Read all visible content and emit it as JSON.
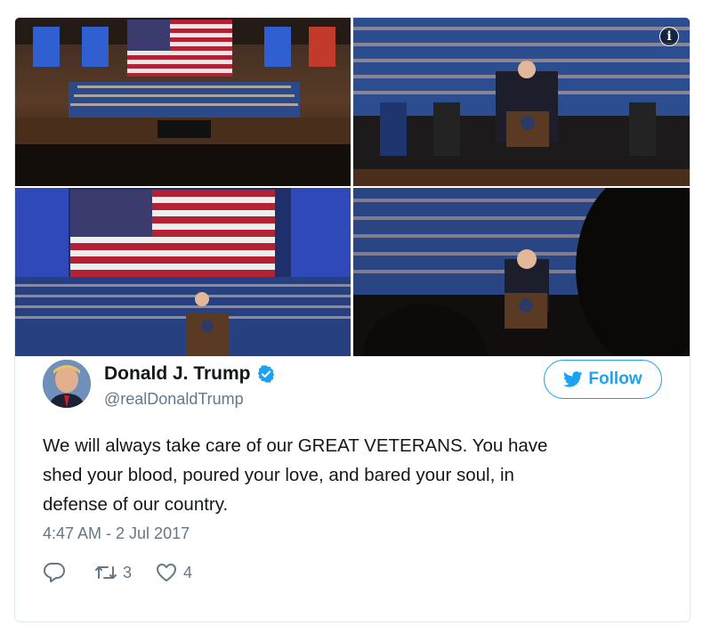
{
  "media": {
    "photos": [
      {
        "name": "photo-concert-hall-wide"
      },
      {
        "name": "photo-podium-speech"
      },
      {
        "name": "photo-flag-choir-stage"
      },
      {
        "name": "photo-podium-closeup"
      }
    ],
    "info_icon_glyph": "i"
  },
  "user": {
    "display_name": "Donald J. Trump",
    "handle": "@realDonaldTrump",
    "verified": true
  },
  "follow_button": {
    "label": "Follow"
  },
  "tweet": {
    "text": "We will always take care of our GREAT VETERANS. You have\nshed your blood, poured your love, and bared your soul, in\ndefense of our country.",
    "timestamp": "4:47 AM - 2 Jul 2017"
  },
  "actions": {
    "reply": {
      "icon": "reply-icon",
      "count": ""
    },
    "retweet": {
      "icon": "retweet-icon",
      "count": "3"
    },
    "like": {
      "icon": "heart-icon",
      "count": "4"
    }
  },
  "colors": {
    "brand_blue": "#1da1f2",
    "text_primary": "#14171a",
    "text_secondary": "#657786",
    "border": "#e1e8ed"
  }
}
